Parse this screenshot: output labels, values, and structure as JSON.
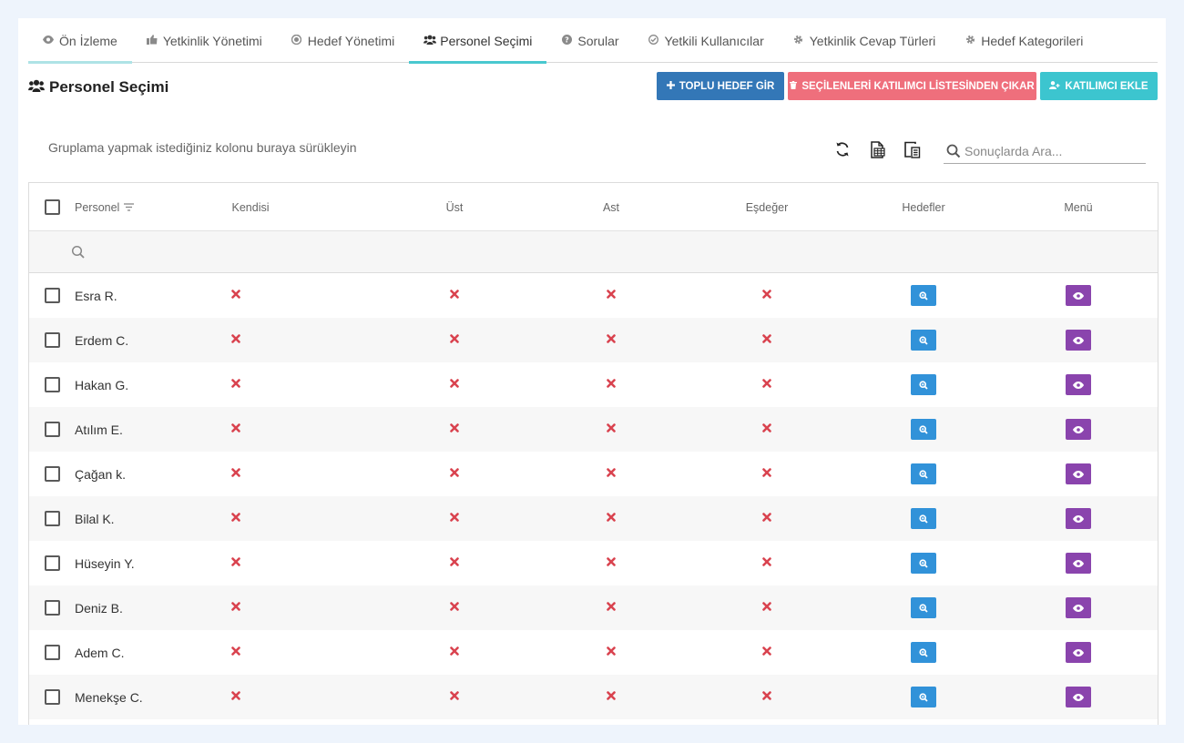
{
  "tabs": [
    {
      "label": "Ön İzleme",
      "icon": "eye-icon"
    },
    {
      "label": "Yetkinlik Yönetimi",
      "icon": "thumbs-up-icon"
    },
    {
      "label": "Hedef Yönetimi",
      "icon": "target-icon"
    },
    {
      "label": "Personel Seçimi",
      "icon": "users-icon"
    },
    {
      "label": "Sorular",
      "icon": "question-icon"
    },
    {
      "label": "Yetkili Kullanıcılar",
      "icon": "check-circle-icon"
    },
    {
      "label": "Yetkinlik Cevap Türleri",
      "icon": "gear-icon"
    },
    {
      "label": "Hedef Kategorileri",
      "icon": "gear-icon"
    }
  ],
  "active_tab": "Personel Seçimi",
  "page": {
    "title": "Personel Seçimi"
  },
  "actions": {
    "bulk_goal": "TOPLU HEDEF GİR",
    "remove_selected": "SEÇİLENLERİ KATILIMCI LİSTESİNDEN ÇIKAR",
    "add_participant": "KATILIMCI EKLE"
  },
  "toolbar": {
    "group_hint": "Gruplama yapmak istediğiniz kolonu buraya sürükleyin",
    "search_placeholder": "Sonuçlarda Ara..."
  },
  "grid": {
    "columns": {
      "personel": "Personel",
      "kendisi": "Kendisi",
      "ust": "Üst",
      "ast": "Ast",
      "esdeger": "Eşdeğer",
      "hedefler": "Hedefler",
      "menu": "Menü"
    },
    "rows": [
      {
        "name": "Esra R.",
        "kendisi": false,
        "ust": false,
        "ast": false,
        "esdeger": false
      },
      {
        "name": "Erdem C.",
        "kendisi": false,
        "ust": false,
        "ast": false,
        "esdeger": false
      },
      {
        "name": "Hakan G.",
        "kendisi": false,
        "ust": false,
        "ast": false,
        "esdeger": false
      },
      {
        "name": "Atılım E.",
        "kendisi": false,
        "ust": false,
        "ast": false,
        "esdeger": false
      },
      {
        "name": "Çağan k.",
        "kendisi": false,
        "ust": false,
        "ast": false,
        "esdeger": false
      },
      {
        "name": "Bilal K.",
        "kendisi": false,
        "ust": false,
        "ast": false,
        "esdeger": false
      },
      {
        "name": "Hüseyin Y.",
        "kendisi": false,
        "ust": false,
        "ast": false,
        "esdeger": false
      },
      {
        "name": "Deniz B.",
        "kendisi": false,
        "ust": false,
        "ast": false,
        "esdeger": false
      },
      {
        "name": "Adem C.",
        "kendisi": false,
        "ust": false,
        "ast": false,
        "esdeger": false
      },
      {
        "name": "Menekşe C.",
        "kendisi": false,
        "ust": false,
        "ast": false,
        "esdeger": false
      }
    ]
  },
  "colors": {
    "active_tab_underline": "#49c8cf",
    "blue_button": "#3377b7",
    "red_button": "#ef6f7c",
    "cyan_button": "#3cc5cf",
    "cross": "#d9434f",
    "goals_button": "#3192d9",
    "menu_button": "#8a44ad"
  }
}
